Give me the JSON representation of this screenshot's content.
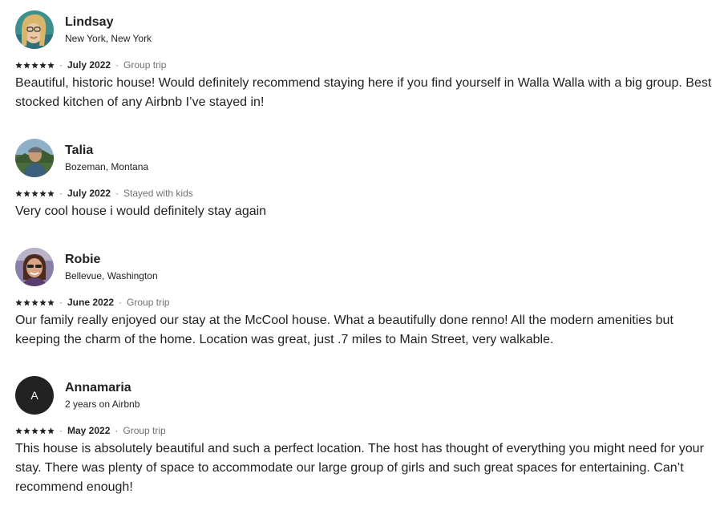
{
  "reviews": [
    {
      "name": "Lindsay",
      "location": "New York, New York",
      "rating": 5,
      "date": "July 2022",
      "trip_type": "Group trip",
      "text": "Beautiful, historic house! Would definitely recommend staying here if you find yourself in Walla Walla with a big group. Best stocked kitchen of any Airbnb I’ve stayed in!"
    },
    {
      "name": "Talia",
      "location": "Bozeman, Montana",
      "rating": 5,
      "date": "July 2022",
      "trip_type": "Stayed with kids",
      "text": "Very cool house i would definitely stay again"
    },
    {
      "name": "Robie",
      "location": "Bellevue, Washington",
      "rating": 5,
      "date": "June 2022",
      "trip_type": "Group trip",
      "text": "Our family really enjoyed our stay at the McCool house. What a beautifully done renno! All the modern amenities but keeping the charm of the home. Location was great, just .7 miles to Main Street, very walkable."
    },
    {
      "name": "Annamaria",
      "avatar_letter": "A",
      "location": "2 years on Airbnb",
      "rating": 5,
      "date": "May 2022",
      "trip_type": "Group trip",
      "text": "This house is absolutely beautiful and such a perfect location. The host has thought of everything you might need for your stay. There was plenty of space to accommodate our large group of girls and such great spaces for entertaining. Can’t recommend enough!"
    }
  ],
  "separator": "·",
  "colors": {
    "text": "#222222",
    "muted": "#717171",
    "avatar_bg": "#222222"
  }
}
